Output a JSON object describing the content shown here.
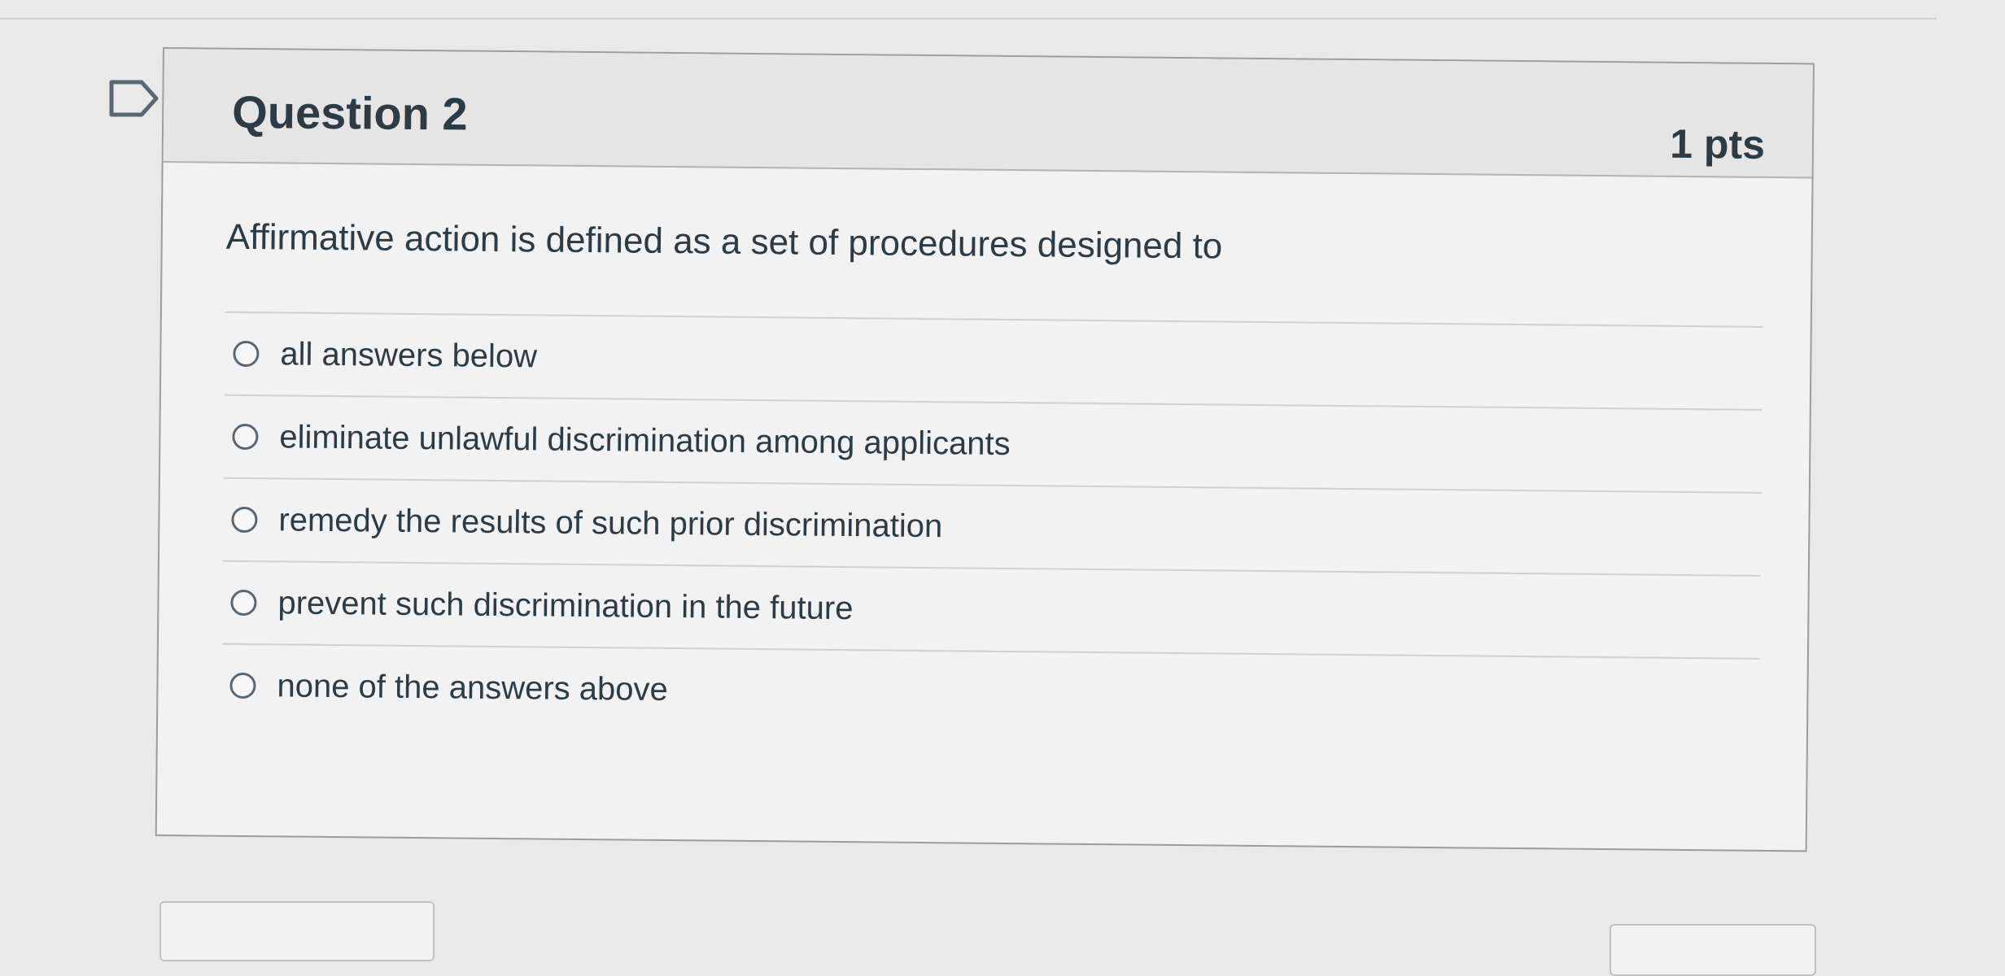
{
  "question": {
    "title": "Question 2",
    "points": "1 pts",
    "text": "Affirmative action is defined as a set of procedures designed to",
    "flag_icon": "flag-outline-icon",
    "answer_icon": "radio-unselected-icon",
    "answers": [
      {
        "label": "all answers below"
      },
      {
        "label": "eliminate unlawful discrimination among applicants"
      },
      {
        "label": "remedy the results of such prior discrimination"
      },
      {
        "label": "prevent such discrimination in the future"
      },
      {
        "label": "none of the answers above"
      }
    ]
  },
  "colors": {
    "page_background": "#e9e9e9",
    "card_background": "#f2f2f2",
    "header_background": "#e5e5e5",
    "text": "#2d3b45",
    "border": "#9c9c9c"
  }
}
